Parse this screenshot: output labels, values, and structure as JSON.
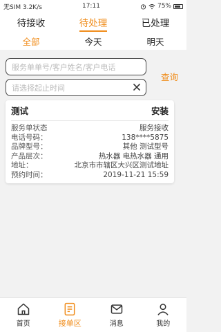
{
  "status_bar": {
    "carrier": "无SIM 3.2K/s",
    "time": "17:11",
    "battery": "75%"
  },
  "top_tabs": [
    {
      "label": "待接收"
    },
    {
      "label": "待处理"
    },
    {
      "label": "已处理"
    }
  ],
  "sub_tabs": [
    {
      "label": "全部"
    },
    {
      "label": "今天"
    },
    {
      "label": "明天"
    }
  ],
  "search": {
    "keyword_placeholder": "服务单单号/客户姓名/客户电话",
    "date_placeholder": "请选择起止时间",
    "query_label": "查询"
  },
  "card": {
    "title_left": "测试",
    "title_right": "安装",
    "rows": [
      {
        "label": "服务单状态",
        "value": "服务接收"
      },
      {
        "label": "电话号码：",
        "value": "138****5875"
      },
      {
        "label": "品牌型号：",
        "value": "其他 测试型号"
      },
      {
        "label": "产品层次：",
        "value": "热水器 电热水器 通用"
      },
      {
        "label": "地址：",
        "value": "北京市市辖区大兴区测试地址"
      },
      {
        "label": "预约时间：",
        "value": "2019-11-21 15:59"
      }
    ]
  },
  "bottom_nav": [
    {
      "label": "首页",
      "icon": "home-icon"
    },
    {
      "label": "接单区",
      "icon": "order-icon"
    },
    {
      "label": "消息",
      "icon": "message-icon"
    },
    {
      "label": "我的",
      "icon": "user-icon"
    }
  ],
  "colors": {
    "accent": "#f08c1a"
  }
}
